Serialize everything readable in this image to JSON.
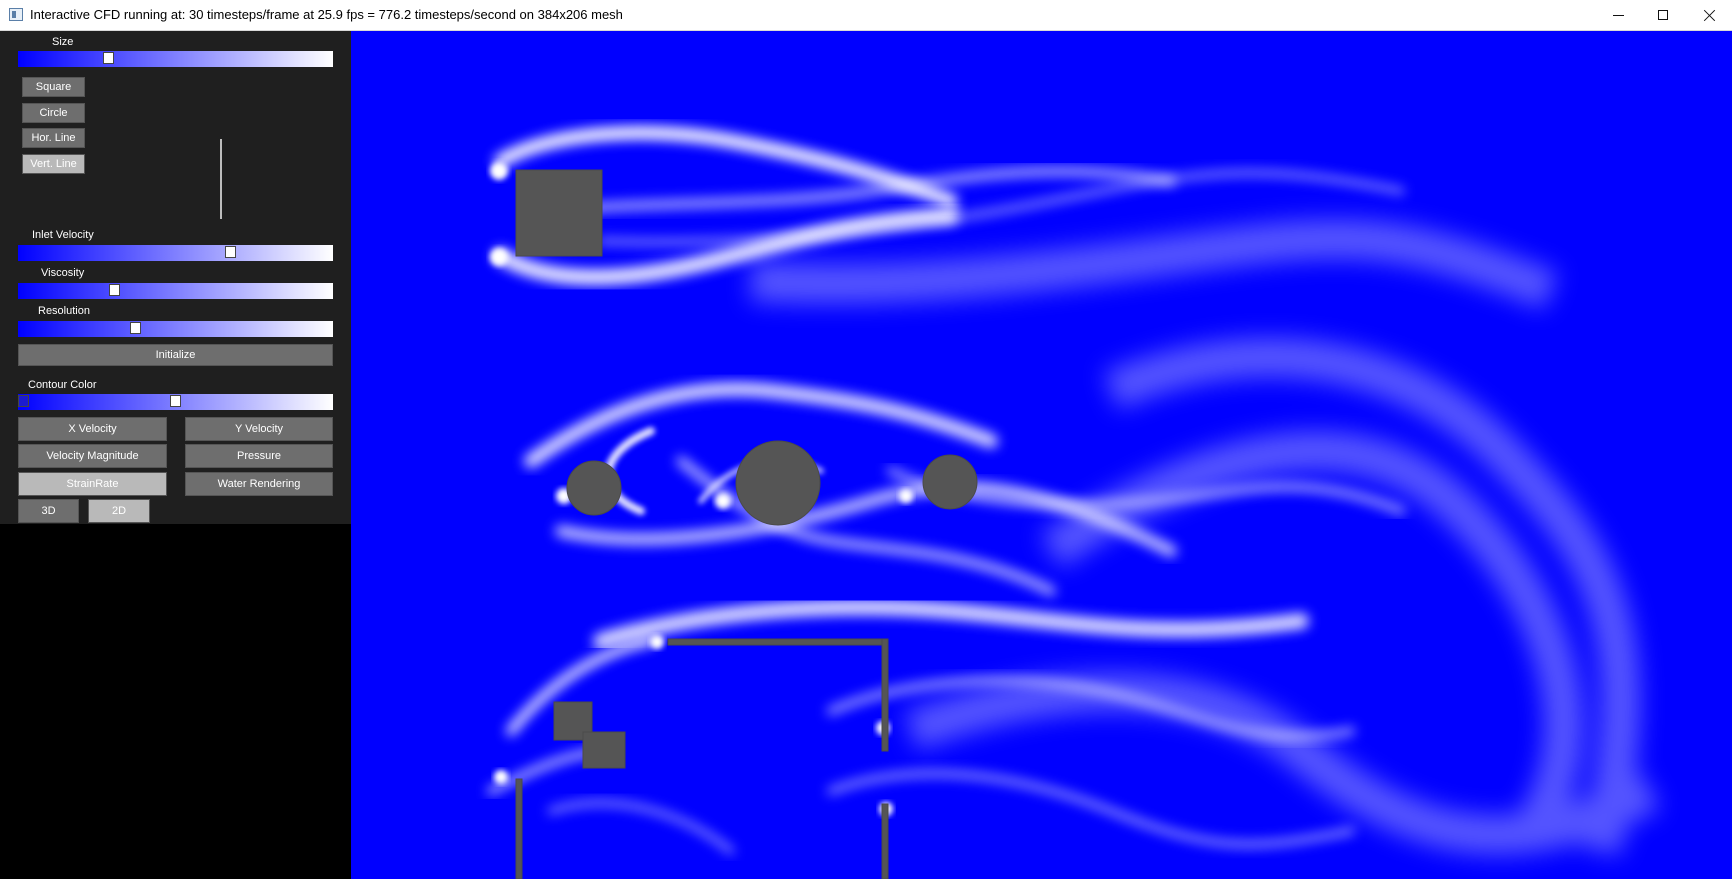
{
  "window": {
    "title": "Interactive CFD running at: 30 timesteps/frame at 25.9 fps = 776.2 timesteps/second on 384x206 mesh",
    "app_icon": "app-window-icon",
    "controls": [
      "minimize-icon",
      "maximize-icon",
      "close-icon"
    ]
  },
  "panel": {
    "size": {
      "label": "Size",
      "value": 0.28
    },
    "shape_buttons": [
      "Square",
      "Circle",
      "Hor. Line",
      "Vert. Line"
    ],
    "selected_shape": "Vert. Line",
    "inlet_velocity": {
      "label": "Inlet Velocity",
      "value": 0.68
    },
    "viscosity": {
      "label": "Viscosity",
      "value": 0.3
    },
    "resolution": {
      "label": "Resolution",
      "value": 0.37
    },
    "initialize_label": "Initialize",
    "contour_color": {
      "label": "Contour Color",
      "low": 0.0,
      "high": 0.5
    },
    "mode_buttons": [
      "X Velocity",
      "Y Velocity",
      "Velocity Magnitude",
      "Pressure",
      "StrainRate",
      "Water Rendering"
    ],
    "selected_mode": "StrainRate",
    "view_buttons": [
      "3D",
      "2D"
    ],
    "selected_view": "2D"
  },
  "colors": {
    "field_base": "#0000ff",
    "field_high": "#ffffff",
    "obstacle": "#555555",
    "panel_bg": "#1f1f1f",
    "button": "#6e6e6e",
    "button_active": "#b9b9b9"
  }
}
